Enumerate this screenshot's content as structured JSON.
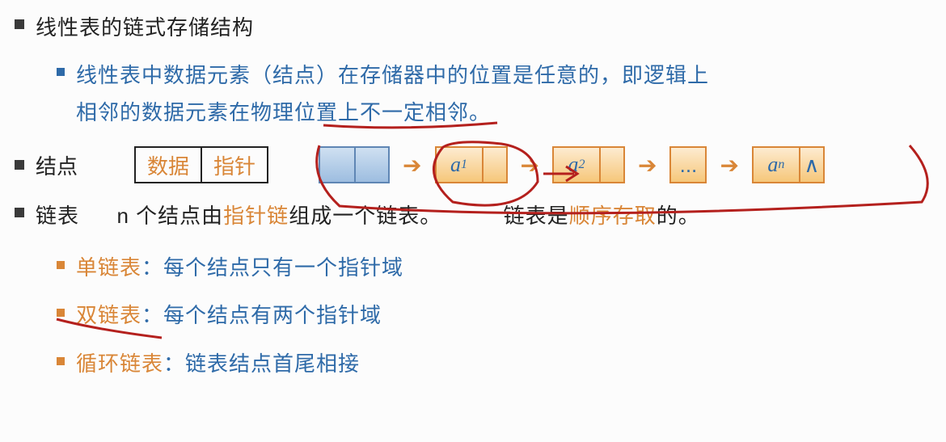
{
  "title": "线性表的链式存储结构",
  "def": {
    "p1": "线性表中数据元素（结点）在存储器中的位置是任意的，即逻辑上",
    "p2": "相邻的数据元素在物理位置上不一定相邻。"
  },
  "node_label": "结点",
  "box_data": "数据",
  "box_ptr": "指针",
  "chain": {
    "a1": "a",
    "s1": "1",
    "a2": "a",
    "s2": "2",
    "dots": "...",
    "an": "a",
    "sn": "n",
    "end": "∧"
  },
  "linked": {
    "label": "链表",
    "t1": "n 个结点由",
    "t2": "指针链",
    "t3": "组成一个链表。",
    "t4": "链表是",
    "t5": "顺序存取",
    "t6": "的。"
  },
  "types": {
    "single_h": "单链表",
    "single_b": "：每个结点只有一个指针域",
    "double_h": "双链表",
    "double_b": "：每个结点有两个指针域",
    "circ_h": "循环链表",
    "circ_b": "：链表结点首尾相接"
  }
}
